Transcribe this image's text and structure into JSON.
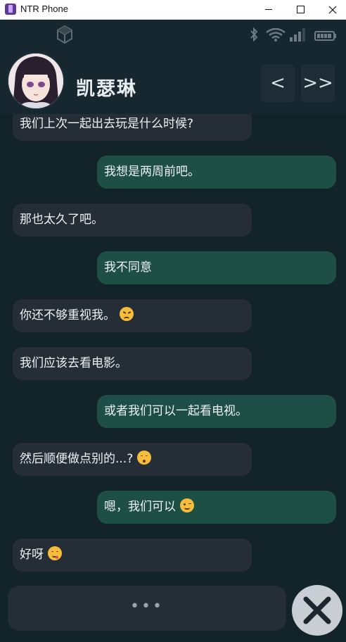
{
  "window": {
    "title": "NTR Phone"
  },
  "status_bar": {
    "icons": [
      "game-logo-icon",
      "bluetooth-icon",
      "wifi-icon",
      "signal-icon",
      "battery-icon"
    ]
  },
  "contact": {
    "name": "凯瑟琳"
  },
  "nav": {
    "back_label": "<",
    "skip_label": ">>"
  },
  "messages": [
    {
      "side": "in",
      "text": "我们上次一起出去玩是什么时候?"
    },
    {
      "side": "out",
      "text": "我想是两周前吧。"
    },
    {
      "side": "in",
      "text": "那也太久了吧。"
    },
    {
      "side": "out",
      "text": "我不同意"
    },
    {
      "side": "in",
      "text": "你还不够重视我。",
      "emoji": "persevering-face-icon"
    },
    {
      "side": "in",
      "text": "我们应该去看电影。"
    },
    {
      "side": "out",
      "text": "或者我们可以一起看电视。"
    },
    {
      "side": "in",
      "text": "然后顺便做点别的...?",
      "emoji": "kissing-face-icon"
    },
    {
      "side": "out",
      "text": "嗯，我们可以",
      "emoji": "winking-face-icon"
    },
    {
      "side": "in",
      "text": "好呀",
      "emoji": "savoring-food-face-icon"
    }
  ],
  "composer": {
    "typing_indicator": "•••"
  },
  "colors": {
    "incoming_bubble": "#252e37",
    "outgoing_bubble": "#1e4f45",
    "background": "#13232a"
  }
}
